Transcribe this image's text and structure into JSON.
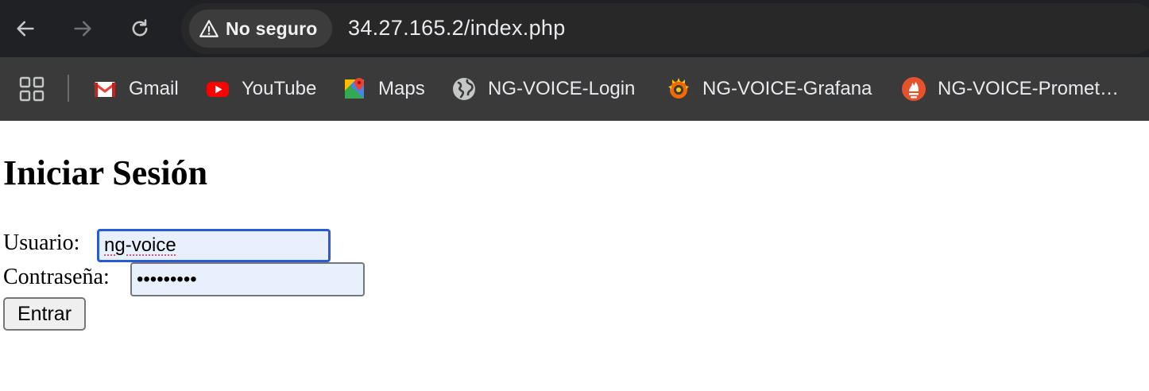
{
  "browser": {
    "security_label": "No seguro",
    "url": "34.27.165.2/index.php",
    "icons": {
      "back": "arrow-left-icon",
      "forward": "arrow-right-icon",
      "reload": "reload-icon",
      "warning": "warning-triangle-icon",
      "apps": "apps-grid-icon"
    }
  },
  "bookmarks": [
    {
      "label": "Gmail",
      "icon": "gmail-icon"
    },
    {
      "label": "YouTube",
      "icon": "youtube-icon"
    },
    {
      "label": "Maps",
      "icon": "maps-icon"
    },
    {
      "label": "NG-VOICE-Login",
      "icon": "globe-icon"
    },
    {
      "label": "NG-VOICE-Grafana",
      "icon": "grafana-icon"
    },
    {
      "label": "NG-VOICE-Promet…",
      "icon": "prometheus-icon"
    }
  ],
  "page": {
    "title": "Iniciar Sesión",
    "username_label": "Usuario:",
    "username_value": "ng-voice",
    "password_label": "Contraseña:",
    "password_masked": "•••••••••",
    "submit_label": "Entrar"
  },
  "colors": {
    "toolbar_bg": "#202124",
    "bookmarks_bg": "#3a3a3a",
    "autofill_bg": "#e8f0fe",
    "focus_ring": "#2a5bd7"
  }
}
